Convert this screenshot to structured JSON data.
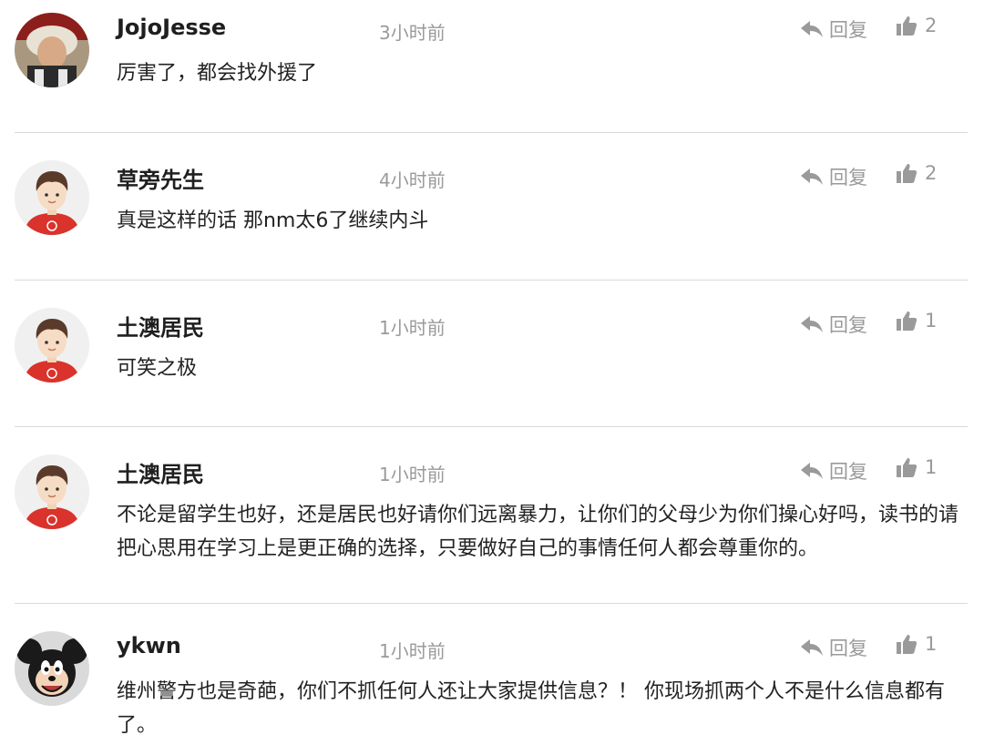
{
  "comments": [
    {
      "username": "JojoJesse",
      "time": "3小时前",
      "reply_label": "回复",
      "likes": "2",
      "text": "厉害了，都会找外援了",
      "avatar": "photo-avatar"
    },
    {
      "username": "草旁先生",
      "time": "4小时前",
      "reply_label": "回复",
      "likes": "2",
      "text": "真是这样的话 那nm太6了继续内斗",
      "avatar": "default-boy-avatar"
    },
    {
      "username": "土澳居民",
      "time": "1小时前",
      "reply_label": "回复",
      "likes": "1",
      "text": "可笑之极",
      "avatar": "default-boy-avatar"
    },
    {
      "username": "土澳居民",
      "time": "1小时前",
      "reply_label": "回复",
      "likes": "1",
      "text": "不论是留学生也好，还是居民也好请你们远离暴力，让你们的父母少为你们操心好吗，读书的请把心思用在学习上是更正确的选择，只要做好自己的事情任何人都会尊重你的。",
      "avatar": "default-boy-avatar"
    },
    {
      "username": "ykwn",
      "time": "1小时前",
      "reply_label": "回复",
      "likes": "1",
      "text": "维州警方也是奇葩，你们不抓任何人还让大家提供信息？！ 你现场抓两个人不是什么信息都有了。",
      "avatar": "mickey-avatar"
    }
  ],
  "colors": {
    "muted": "#9a9a9a",
    "divider": "#d9d9d9",
    "avatar_shirt": "#d9332b"
  }
}
